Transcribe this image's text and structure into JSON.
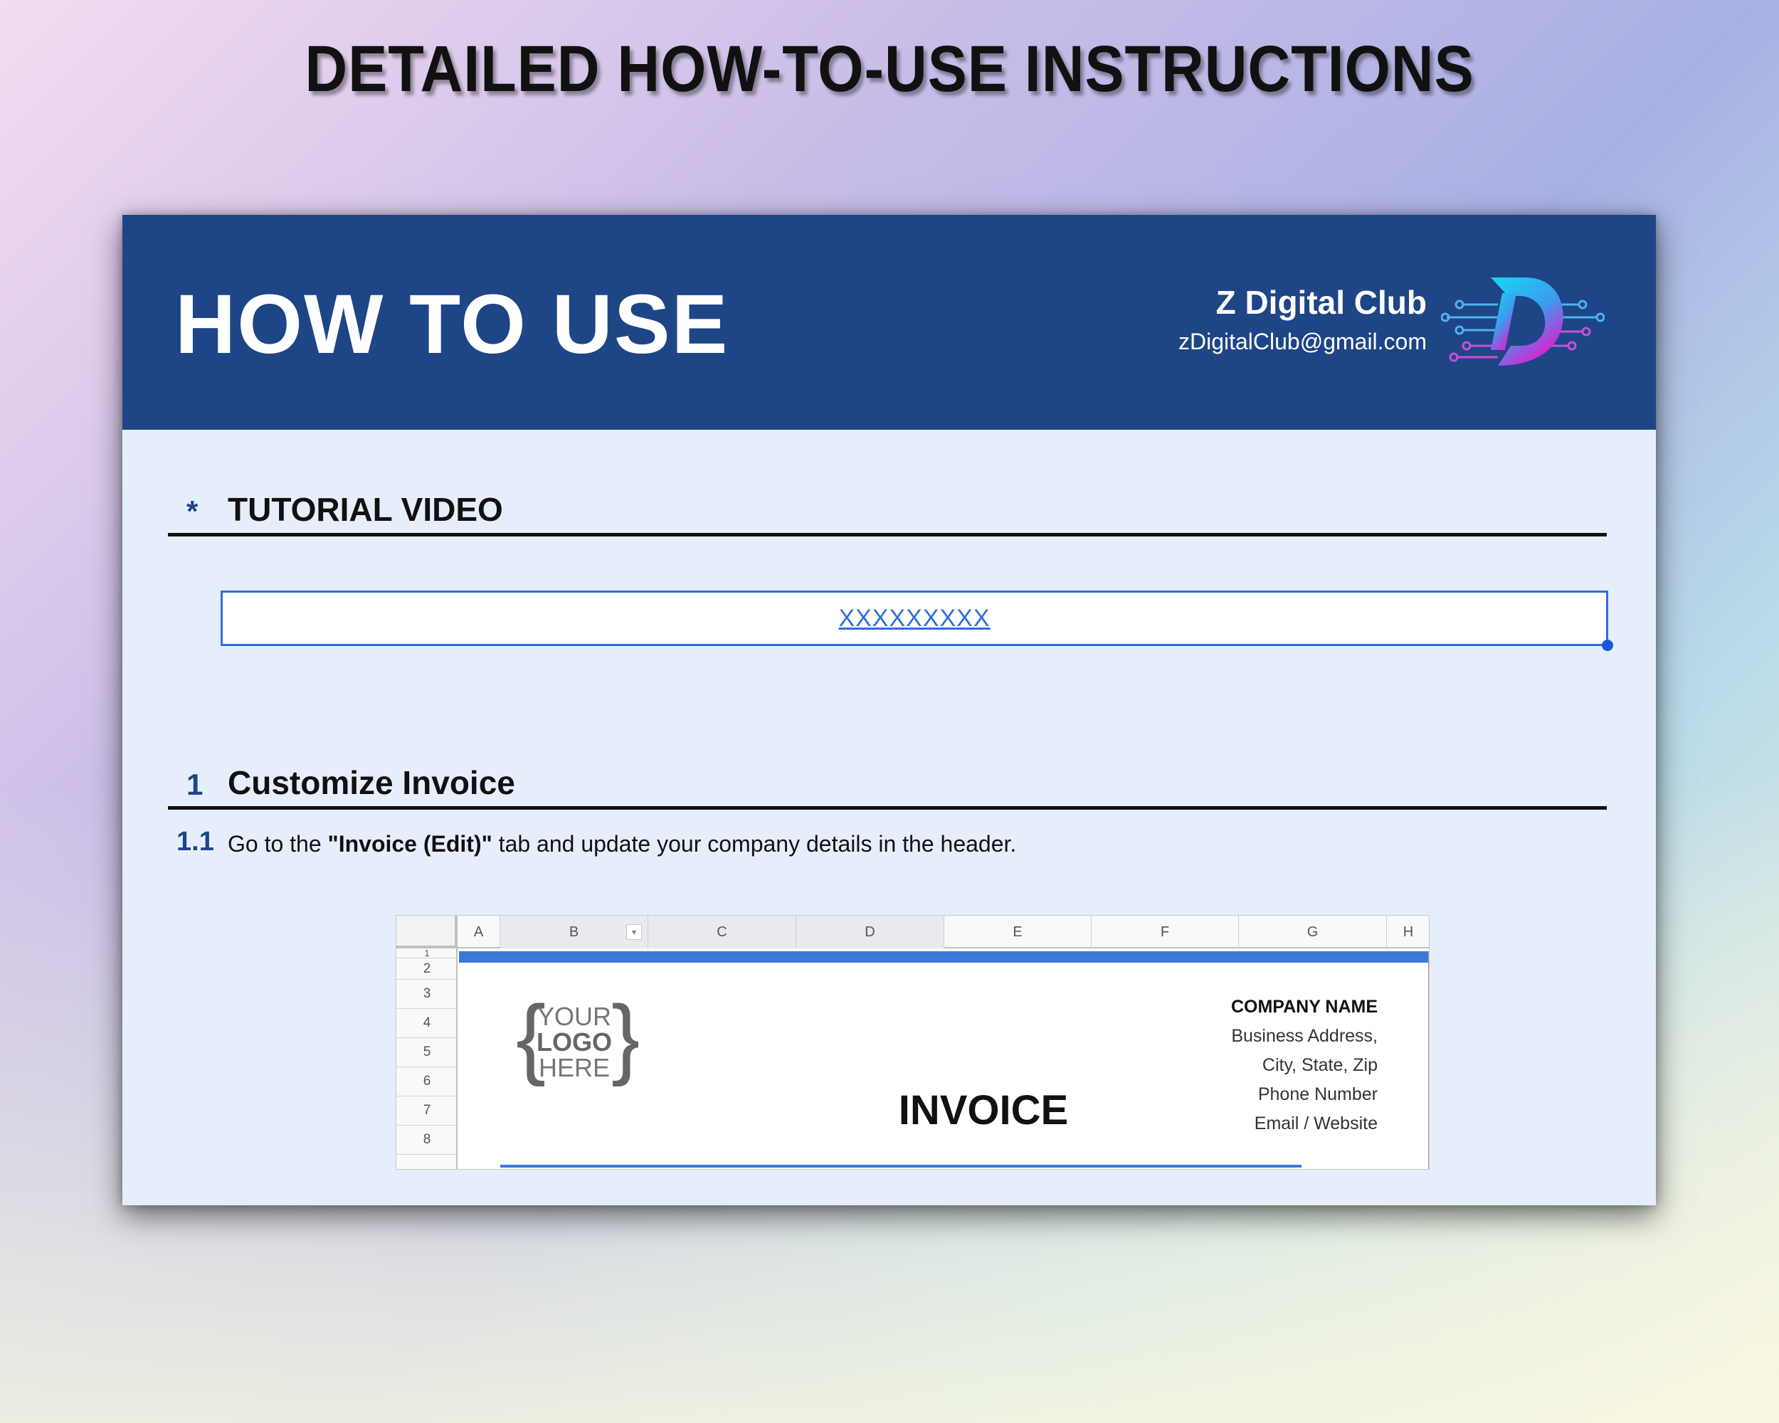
{
  "page": {
    "title": "DETAILED HOW-TO-USE INSTRUCTIONS"
  },
  "banner": {
    "title": "HOW TO USE",
    "brand_name": "Z Digital Club",
    "brand_email": "zDigitalClub@gmail.com",
    "logo_icon": "circuit-d-logo-icon"
  },
  "tutorial": {
    "marker": "*",
    "heading": "TUTORIAL VIDEO",
    "link_text": "XXXXXXXXX"
  },
  "section1": {
    "number": "1",
    "heading": "Customize Invoice",
    "steps": [
      {
        "number": "1.1",
        "text_before": "Go to the ",
        "text_bold": "\"Invoice (Edit)\"",
        "text_after": " tab and update your company details in the header."
      }
    ]
  },
  "spreadsheet": {
    "columns": [
      "A",
      "B",
      "C",
      "D",
      "E",
      "F",
      "G",
      "H"
    ],
    "rows": [
      "1",
      "2",
      "3",
      "4",
      "5",
      "6",
      "7",
      "8"
    ],
    "logo_placeholder": [
      "YOUR",
      "LOGO",
      "HERE"
    ],
    "invoice_title": "INVOICE",
    "company_lines": [
      "COMPANY NAME",
      "Business Address,",
      "City, State, Zip",
      "Phone Number",
      "Email / Website"
    ],
    "accent_color": "#3c78d8"
  },
  "colors": {
    "banner": "#1e4586",
    "sheet_background": "#e7eefb",
    "link": "#2f6ed8"
  }
}
